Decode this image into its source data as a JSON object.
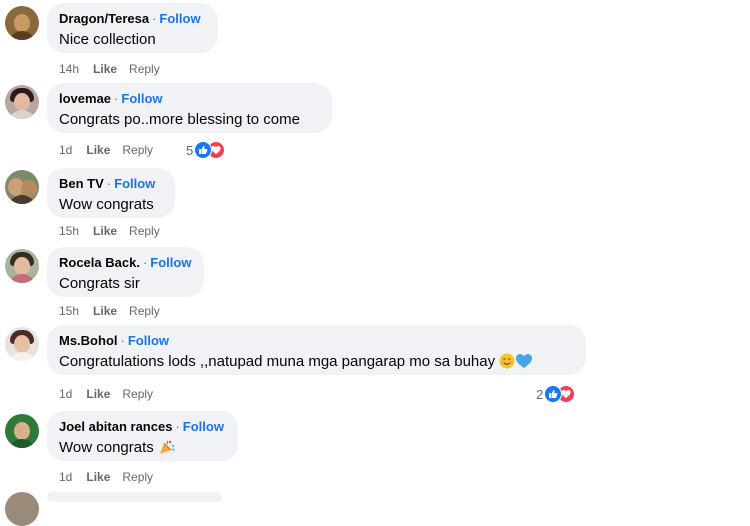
{
  "comments": [
    {
      "name": "Dragon/Teresa",
      "follow": "Follow",
      "text": "Nice collection",
      "time": "14h",
      "like": "Like",
      "reply": "Reply"
    },
    {
      "name": "lovemae",
      "follow": "Follow",
      "text": "Congrats po..more blessing to come",
      "time": "1d",
      "like": "Like",
      "reply": "Reply",
      "reactions": "5"
    },
    {
      "name": "Ben TV",
      "follow": "Follow",
      "text": "Wow congrats",
      "time": "15h",
      "like": "Like",
      "reply": "Reply"
    },
    {
      "name": "Rocela Back.",
      "follow": "Follow",
      "text": "Congrats sir",
      "time": "15h",
      "like": "Like",
      "reply": "Reply"
    },
    {
      "name": "Ms.Bohol",
      "follow": "Follow",
      "text": "Congratulations lods ,,natupad muna mga pangarap mo sa buhay",
      "time": "1d",
      "like": "Like",
      "reply": "Reply",
      "reactions": "2"
    },
    {
      "name": "Joel abitan rances",
      "follow": "Follow",
      "text": "Wow congrats",
      "time": "1d",
      "like": "Like",
      "reply": "Reply"
    }
  ],
  "separator": "·",
  "colors": {
    "bubble": "#f0f2f5",
    "link": "#1b74e4",
    "meta": "#65676b",
    "like_reaction": "#1877f2",
    "love_reaction": "#f33e58"
  },
  "icons": {
    "reaction_like": "thumbs-up-icon",
    "reaction_love": "heart-icon",
    "emoji_smile": "smiling-face-icon",
    "emoji_heart": "blue-heart-icon",
    "emoji_party": "party-popper-icon"
  }
}
